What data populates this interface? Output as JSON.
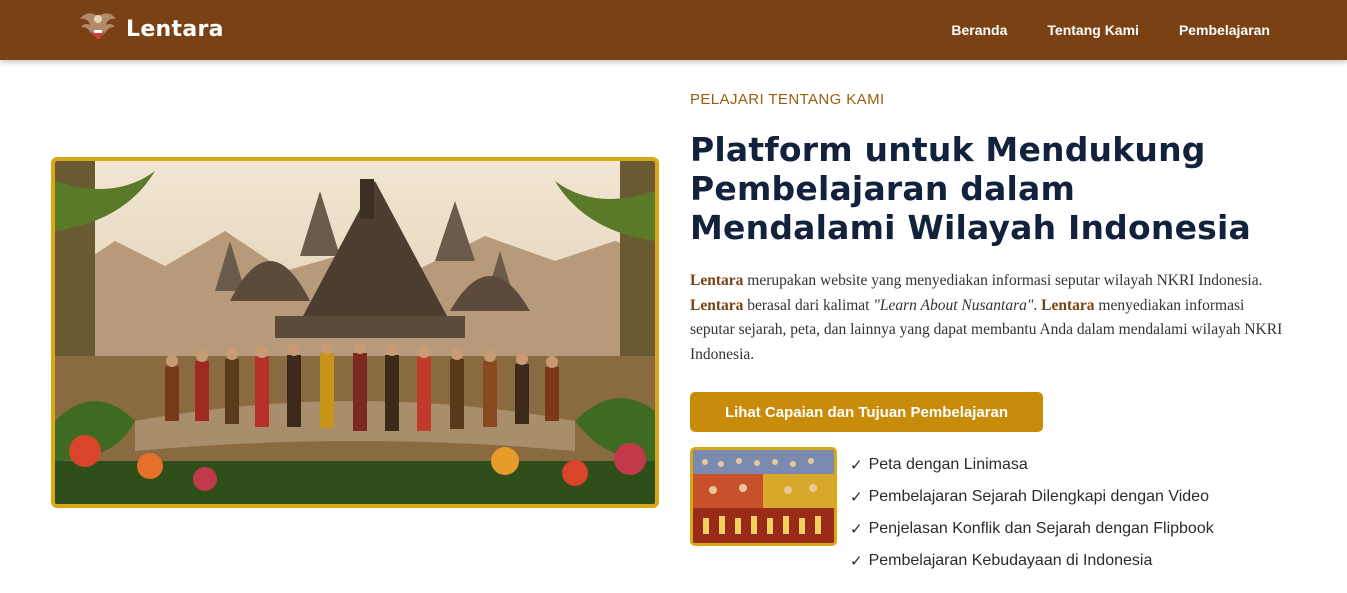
{
  "nav": {
    "brand": "Lentara",
    "logo_icon": "garuda-icon",
    "links": [
      "Beranda",
      "Tentang Kami",
      "Pembelajaran"
    ]
  },
  "about": {
    "eyebrow": "PELAJARI TENTANG KAMI",
    "title": "Platform untuk Mendukung Pembelajaran dalam Mendalami Wilayah Indonesia",
    "description": {
      "brand": "Lentara",
      "part1": " merupakan website yang menyediakan informasi seputar wilayah NKRI Indonesia. ",
      "part2": " berasal dari kalimat ",
      "quote": "\"Learn About Nusantara\"",
      "part3": ". ",
      "part4": " menyediakan informasi seputar sejarah, peta, dan lainnya yang dapat membantu Anda dalam mendalami wilayah NKRI Indonesia."
    },
    "cta_label": "Lihat Capaian dan Tujuan Pembelajaran",
    "check_symbol": "✓",
    "features": [
      "Peta dengan Linimasa",
      "Pembelajaran Sejarah Dilengkapi dengan Video",
      "Penjelasan Konflik dan Sejarah dengan Flipbook",
      "Pembelajaran Kebudayaan di Indonesia"
    ]
  },
  "colors": {
    "navbar": "#7a4114",
    "accent_gold": "#d9a816",
    "button": "#c98b0a",
    "title": "#12223d",
    "eyebrow": "#9a5e10"
  }
}
